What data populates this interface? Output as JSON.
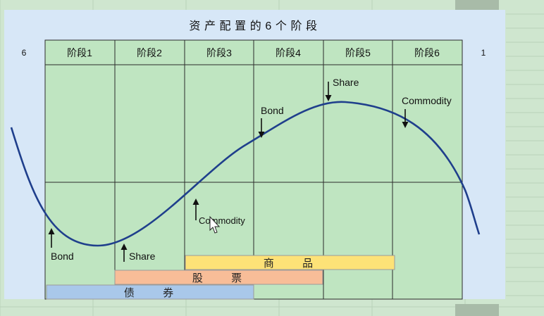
{
  "diagram": {
    "title": "资产配置的6个阶段",
    "left_marker": "6",
    "right_marker": "1",
    "stages": [
      "阶段1",
      "阶段2",
      "阶段3",
      "阶段4",
      "阶段5",
      "阶段6"
    ],
    "annotations": [
      {
        "text": "Bond",
        "direction": "up"
      },
      {
        "text": "Share",
        "direction": "up"
      },
      {
        "text": "Commodity",
        "direction": "up"
      },
      {
        "text": "Bond",
        "direction": "down"
      },
      {
        "text": "Share",
        "direction": "down"
      },
      {
        "text": "Commodity",
        "direction": "down"
      }
    ],
    "bands": [
      {
        "label": "商 品",
        "color": "#fde277"
      },
      {
        "label": "股 票",
        "color": "#f8bd98"
      },
      {
        "label": "债 券",
        "color": "#a9c8ea"
      }
    ]
  },
  "colors": {
    "curve": "#1f3f8c",
    "stage_fill": "#bfe5c1",
    "panel": "#d7e7f7"
  }
}
